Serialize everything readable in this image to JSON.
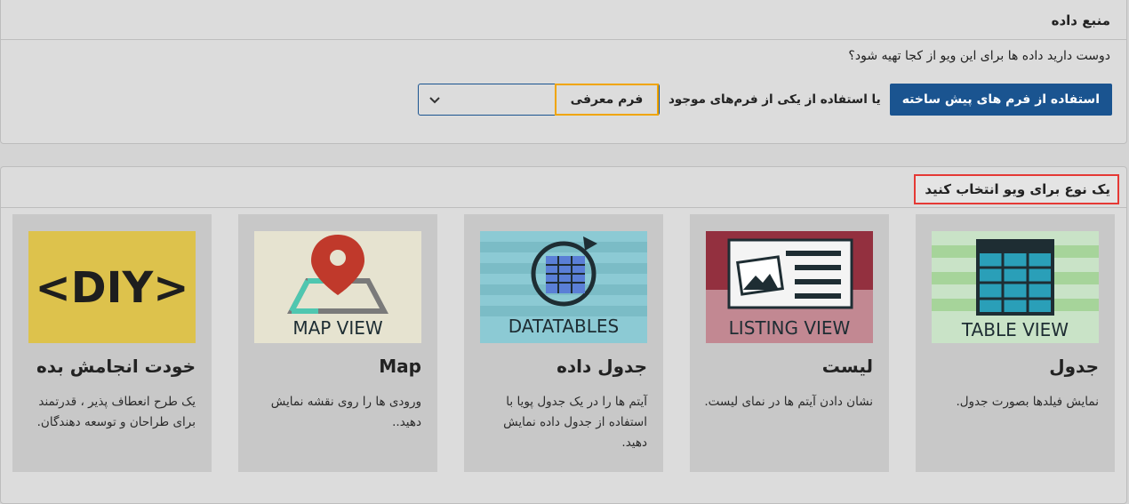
{
  "data_source": {
    "title": "منبع داده",
    "question": "دوست دارید داده ها برای این ویو از کجا تهیه شود؟",
    "prebuilt_button": "استفاده از فرم های پیش ساخته",
    "or_label": "یا استفاده از یکی از فرم‌های موجود",
    "selected_form": "فرم معرفی"
  },
  "view_types": {
    "title": "یک نوع برای ویو انتخاب کنید",
    "cards": [
      {
        "title": "جدول",
        "description": "نمایش فیلدها بصورت جدول.",
        "image_caption": "TABLE VIEW",
        "icon": "table-icon"
      },
      {
        "title": "لیست",
        "description": "نشان دادن آیتم ها در نمای لیست.",
        "image_caption": "LISTING VIEW",
        "icon": "listing-icon"
      },
      {
        "title": "جدول داده",
        "description": "آیتم ها را در یک جدول پویا با استفاده از جدول داده نمایش دهید.",
        "image_caption": "DATATABLES",
        "icon": "datatables-icon"
      },
      {
        "title": "Map",
        "description": "ورودی ها را روی نقشه نمایش دهید..",
        "image_caption": "MAP VIEW",
        "icon": "map-pin-icon"
      },
      {
        "title": "خودت انجامش بده",
        "description": "یک طرح انعطاف پذیر ، قدرتمند برای طراحان و توسعه دهندگان.",
        "image_caption": "<DIY>",
        "icon": "diy-icon"
      }
    ]
  },
  "colors": {
    "primary_button": "#1a5490",
    "select_highlight": "#f0a500",
    "title_highlight": "#e53935",
    "diy_yellow": "#ddc24c"
  }
}
